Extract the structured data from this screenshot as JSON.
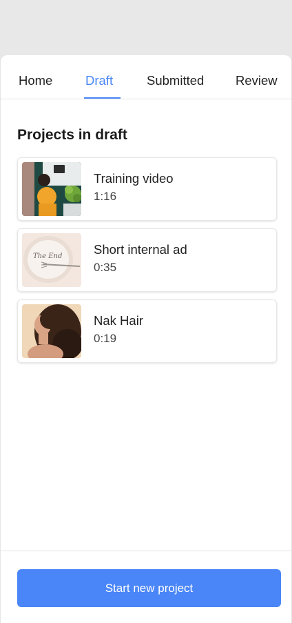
{
  "tabs": [
    {
      "label": "Home",
      "active": false
    },
    {
      "label": "Draft",
      "active": true
    },
    {
      "label": "Submitted",
      "active": false
    },
    {
      "label": "Review",
      "active": false
    }
  ],
  "section_title": "Projects in draft",
  "projects": [
    {
      "title": "Training video",
      "duration": "1:16",
      "thumbnail": "desk-workspace-photo"
    },
    {
      "title": "Short internal ad",
      "duration": "0:35",
      "thumbnail": "the-end-plate-photo",
      "thumbnail_text": "The End"
    },
    {
      "title": "Nak Hair",
      "duration": "0:19",
      "thumbnail": "hair-model-photo"
    }
  ],
  "footer": {
    "button_label": "Start new project"
  },
  "colors": {
    "accent": "#4a86f7",
    "background": "#e8e8e8",
    "surface": "#ffffff"
  }
}
